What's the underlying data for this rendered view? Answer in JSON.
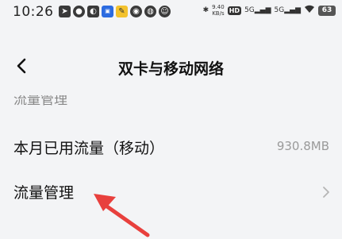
{
  "status_bar": {
    "time": "10:26",
    "notification_icons": [
      "telegram-icon",
      "messages-icon",
      "wechat-icon",
      "qq-browser-icon",
      "notes-icon",
      "chat-bubble-icon",
      "weibo-icon",
      "game-controller-icon"
    ],
    "network_speed": "9.40",
    "network_speed_unit": "KB/s",
    "hd_label": "HD",
    "sim1_label": "5G",
    "sim2_label": "5G",
    "battery_level": "63"
  },
  "header": {
    "back_glyph": "<",
    "title": "双卡与移动网络"
  },
  "section": {
    "partial_header": "流量管理"
  },
  "rows": [
    {
      "label": "本月已用流量（移动）",
      "value": "930.8MB"
    },
    {
      "label": "流量管理"
    }
  ],
  "annotation": {
    "arrow_color": "#e8403d"
  }
}
